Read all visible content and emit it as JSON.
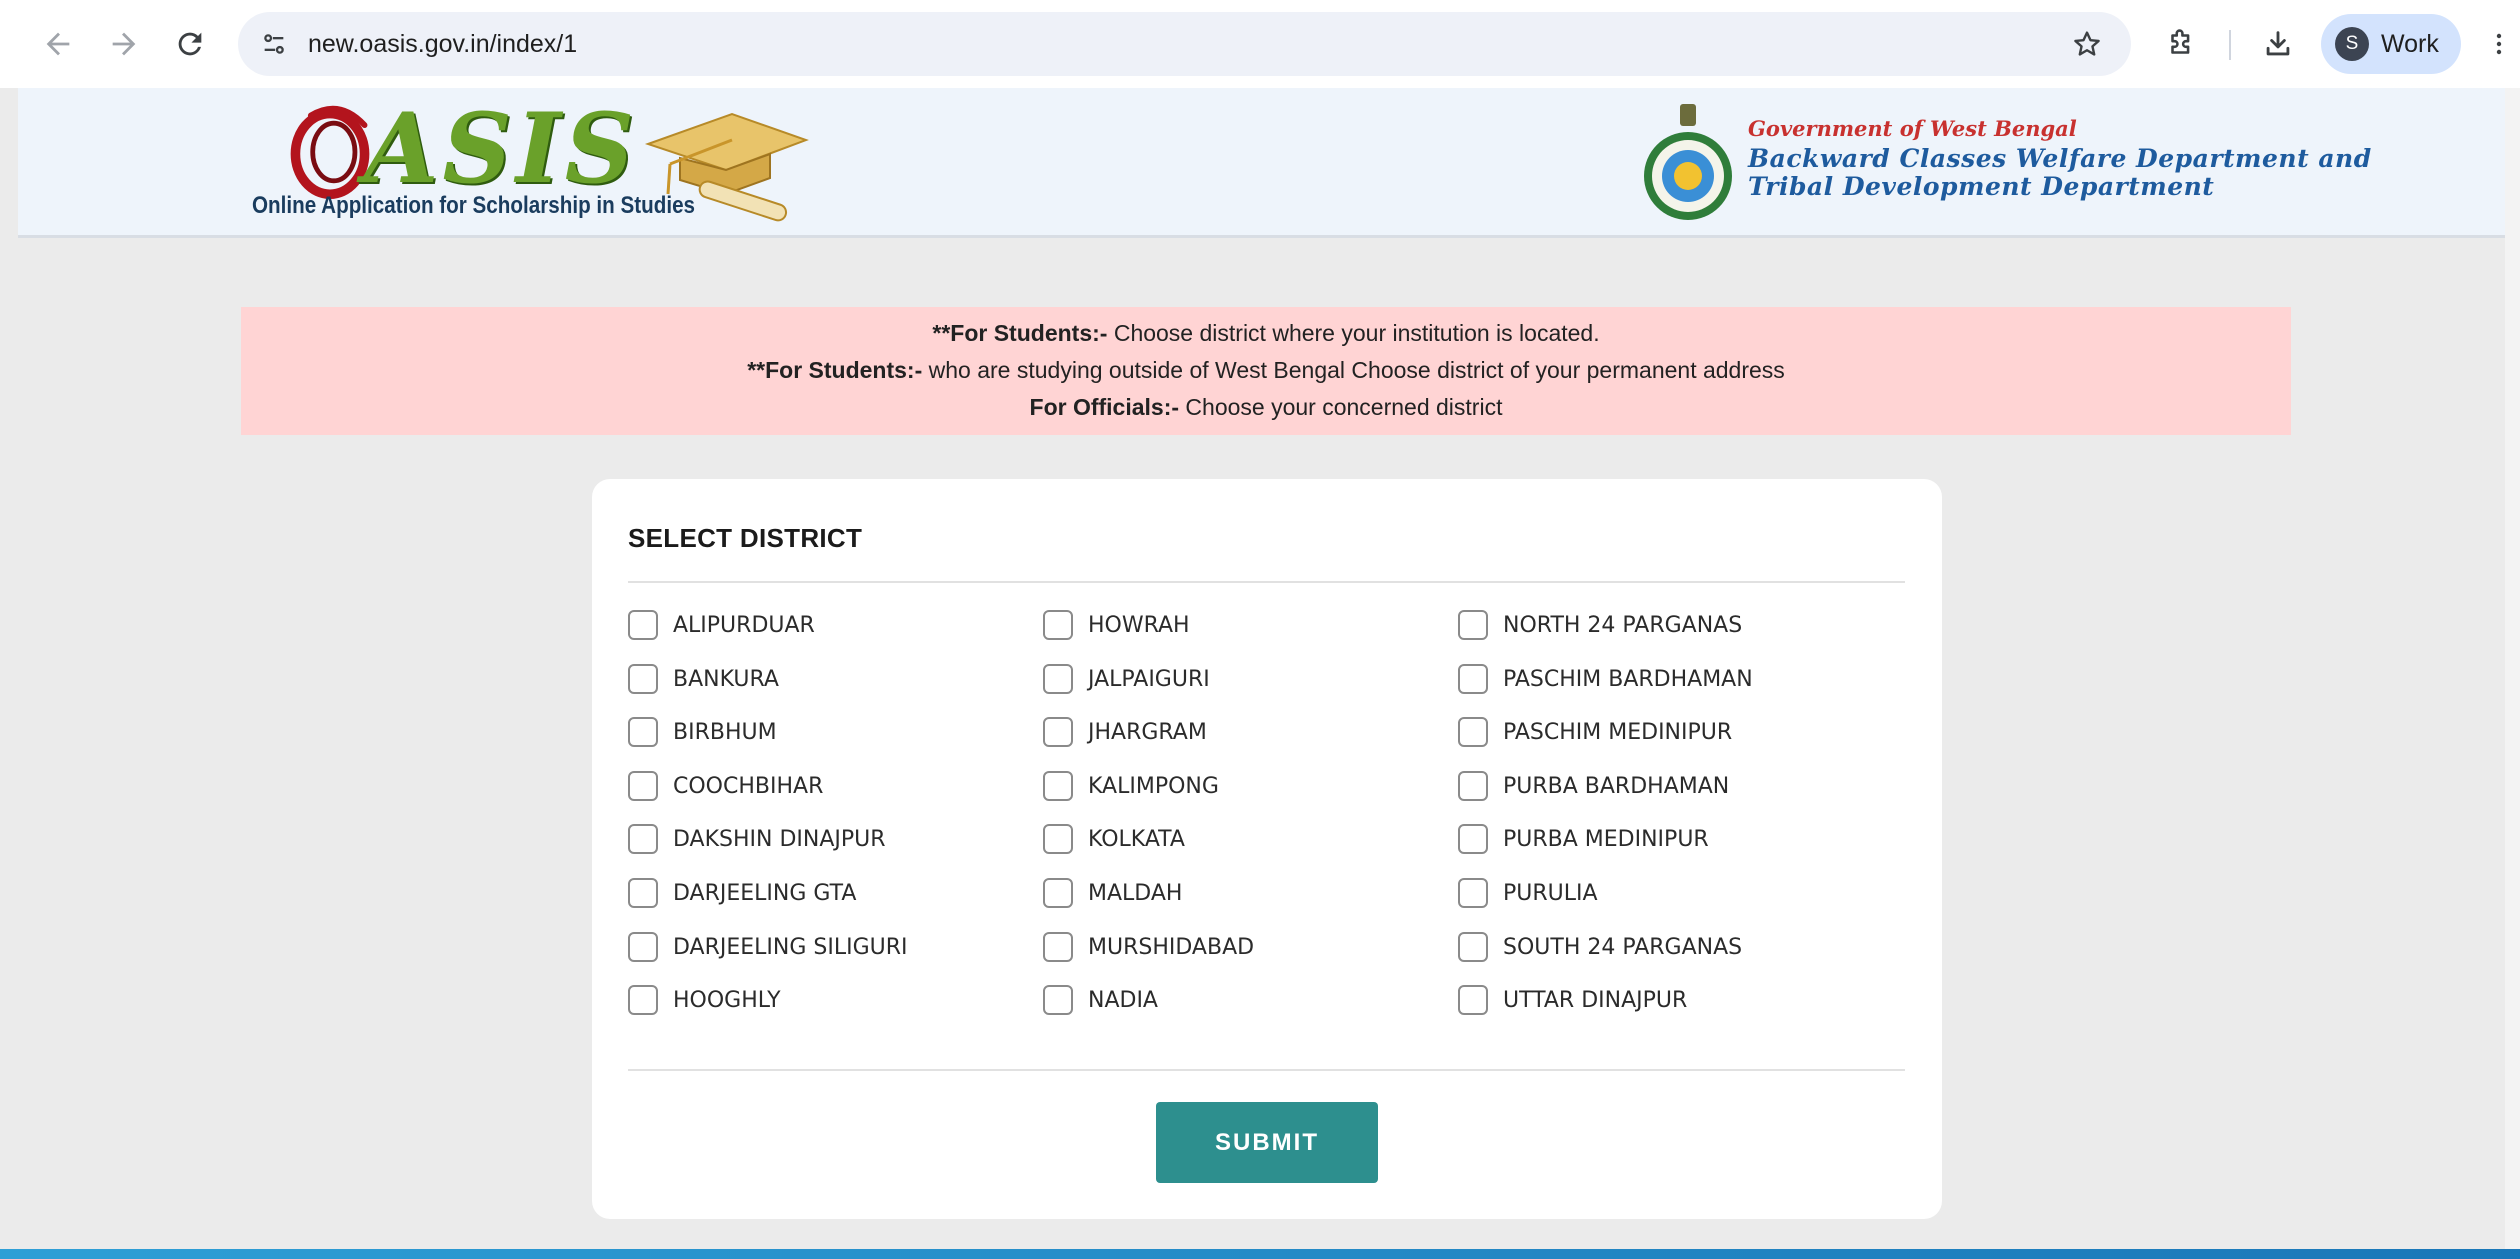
{
  "browser": {
    "url": "new.oasis.gov.in/index/1",
    "profile_initial": "S",
    "profile_name": "Work"
  },
  "header": {
    "logo_word": "ASIS",
    "logo_tagline": "Online Application for Scholarship in Studies",
    "dept_line1": "Government of West Bengal",
    "dept_line2": "Backward Classes Welfare Department and",
    "dept_line3": "Tribal Development Department"
  },
  "notice": {
    "line1_bold": "**For Students:-",
    "line1_text": " Choose district where your institution is located.",
    "line2_bold": "**For Students:-",
    "line2_text": " who are studying outside of West Bengal Choose district of your permanent address",
    "line3_bold": "For Officials:-",
    "line3_text": " Choose your concerned district"
  },
  "form": {
    "title": "SELECT DISTRICT",
    "submit_label": "SUBMIT",
    "columns": [
      [
        "ALIPURDUAR",
        "BANKURA",
        "BIRBHUM",
        "COOCHBIHAR",
        "DAKSHIN DINAJPUR",
        "DARJEELING GTA",
        "DARJEELING SILIGURI",
        "HOOGHLY"
      ],
      [
        "HOWRAH",
        "JALPAIGURI",
        "JHARGRAM",
        "KALIMPONG",
        "KOLKATA",
        "MALDAH",
        "MURSHIDABAD",
        "NADIA"
      ],
      [
        "NORTH 24 PARGANAS",
        "PASCHIM BARDHAMAN",
        "PASCHIM MEDINIPUR",
        "PURBA BARDHAMAN",
        "PURBA MEDINIPUR",
        "PURULIA",
        "SOUTH 24 PARGANAS",
        "UTTAR DINAJPUR"
      ]
    ],
    "checked": []
  },
  "colors": {
    "submit_bg": "#2d8f8e",
    "notice_bg": "#ffd4d4",
    "page_bg": "#ebebeb"
  }
}
